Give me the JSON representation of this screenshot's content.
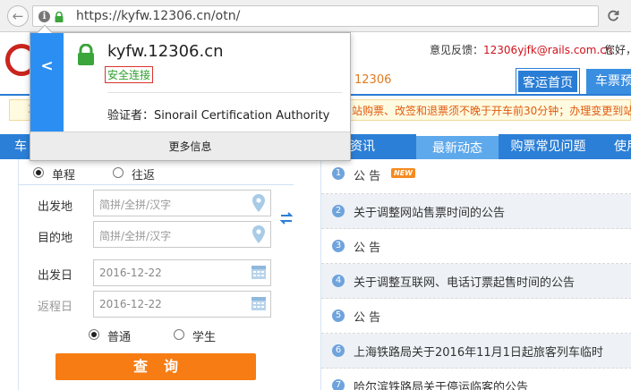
{
  "browser": {
    "url": "https://kyfw.12306.cn/otn/",
    "back_glyph": "←",
    "reload_glyph": "C"
  },
  "header": {
    "feedback_label": "意见反馈：",
    "feedback_email": "12306yjfk@rails.com.cn",
    "greeting": "您好，",
    "phone_fragment": "12306",
    "home_button": "客运首页",
    "booking_button": "车票预"
  },
  "notice": {
    "speaker": "3",
    "text": "站购票、改签和退票须不晚于开车前30分钟；办理变更到站"
  },
  "nav": {
    "items": [
      {
        "label": "车"
      },
      {
        "label": "资讯"
      },
      {
        "label": "最新动态"
      },
      {
        "label": "购票常见问题"
      },
      {
        "label": "使用"
      }
    ]
  },
  "form": {
    "trip_one_way": "单程",
    "trip_round": "往返",
    "from_label": "出发地",
    "from_placeholder": "简拼/全拼/汉字",
    "to_label": "目的地",
    "to_placeholder": "简拼/全拼/汉字",
    "depart_label": "出发日",
    "depart_date": "2016-12-22",
    "return_label": "返程日",
    "return_date": "2016-12-22",
    "type_normal": "普通",
    "type_student": "学生",
    "search_button": "查询"
  },
  "news": {
    "items": [
      {
        "num": "1",
        "text": "公 告",
        "badge": "NEW"
      },
      {
        "num": "2",
        "text": "关于调整网站售票时间的公告"
      },
      {
        "num": "3",
        "text": "公 告"
      },
      {
        "num": "4",
        "text": "关于调整互联网、电话订票起售时间的公告"
      },
      {
        "num": "5",
        "text": "公 告"
      },
      {
        "num": "6",
        "text": "上海铁路局关于2016年11月1日起旅客列车临时"
      },
      {
        "num": "7",
        "text": "哈尔滨铁路局关于停运临客的公告"
      }
    ]
  },
  "popup": {
    "back_glyph": "<",
    "domain": "kyfw.12306.cn",
    "secure_text": "安全连接",
    "verifier": "验证者：Sinorail Certification Authority",
    "more_info": "更多信息"
  },
  "colors": {
    "nav_blue": "#2c7fd6",
    "secure_green": "#2f9e2f",
    "search_orange": "#f77c13",
    "lock_green": "#3aa53a"
  }
}
